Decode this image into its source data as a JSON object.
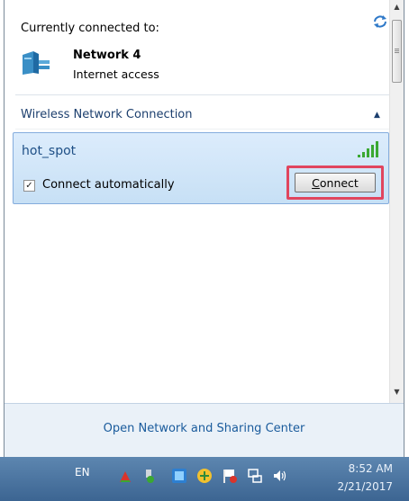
{
  "connected_section": {
    "title": "Currently connected to:",
    "refresh_icon": "refresh-arrows-icon",
    "network": {
      "icon": "network-bench-icon",
      "name": "Network  4",
      "status": "Internet access"
    }
  },
  "wireless_section": {
    "title": "Wireless Network Connection",
    "collapse_icon": "chevron-up-icon",
    "network": {
      "ssid": "hot_spot",
      "signal_icon": "signal-strength-icon",
      "connect_automatically_label": "Connect automatically",
      "connect_automatically_checked": true,
      "connect_button_mnemonic": "C",
      "connect_button_rest": "onnect"
    }
  },
  "footer": {
    "link": "Open Network and Sharing Center"
  },
  "taskbar": {
    "language": "EN",
    "tray_icons": [
      "flag-icon",
      "usb-device-icon",
      "intel-graphics-icon",
      "update-icon",
      "action-center-flag-icon",
      "network-icon",
      "volume-icon"
    ],
    "time": "8:52 AM",
    "date": "2/21/2017"
  },
  "colors": {
    "highlight_border": "#e0455e",
    "selected_item_bg": "#c7e0f5",
    "link": "#1a5b9c",
    "taskbar": "#3c6592"
  }
}
